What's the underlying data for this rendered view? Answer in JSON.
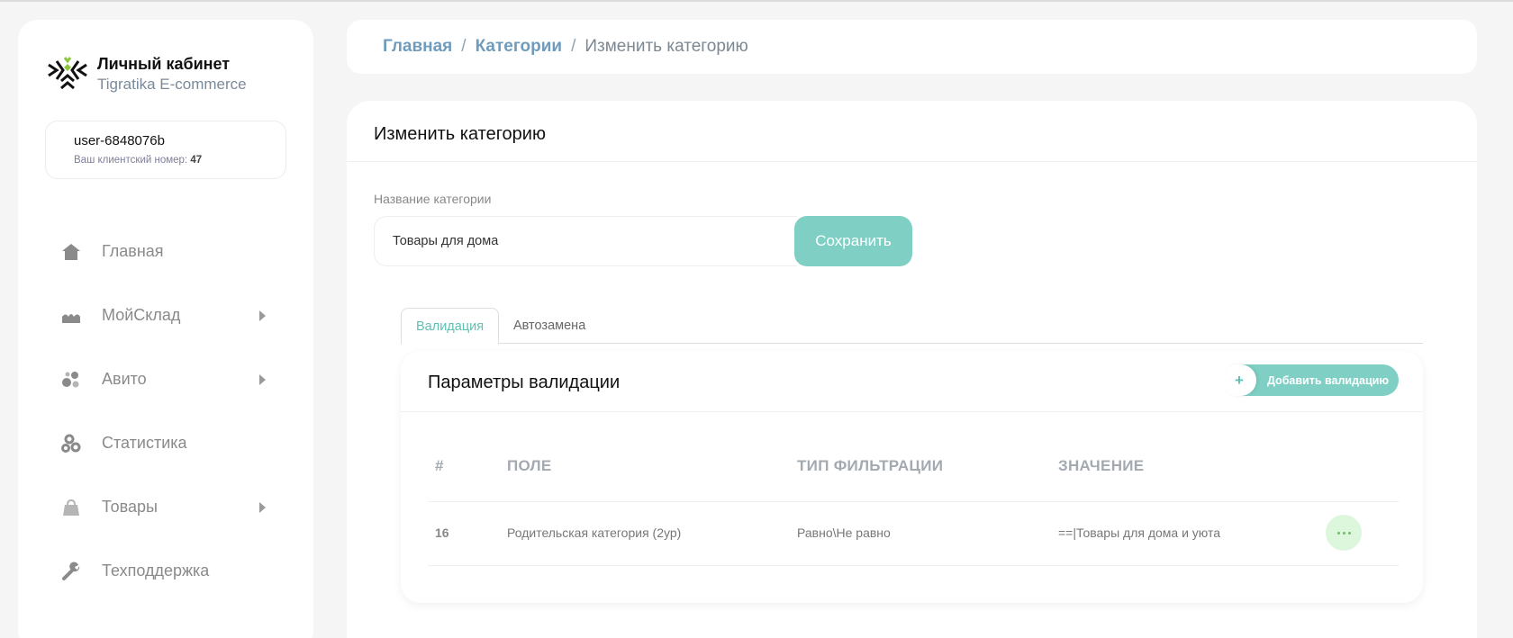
{
  "brand": {
    "title": "Личный кабинет",
    "subtitle": "Tigratika E-commerce"
  },
  "user": {
    "name": "user-6848076b",
    "client_label": "Ваш клиентский номер:",
    "client_number": "47"
  },
  "sidebar": {
    "items": [
      {
        "label": "Главная",
        "icon": "home-icon",
        "has_submenu": false
      },
      {
        "label": "МойСклад",
        "icon": "warehouse-icon",
        "has_submenu": true
      },
      {
        "label": "Авито",
        "icon": "circles-icon",
        "has_submenu": true
      },
      {
        "label": "Статистика",
        "icon": "gears-icon",
        "has_submenu": false
      },
      {
        "label": "Товары",
        "icon": "bag-icon",
        "has_submenu": true
      },
      {
        "label": "Техподдержка",
        "icon": "wrench-icon",
        "has_submenu": false
      }
    ]
  },
  "breadcrumb": {
    "home": "Главная",
    "sep1": "/",
    "categories": "Категории",
    "sep2": "/",
    "current": "Изменить категорию"
  },
  "main": {
    "title": "Изменить категорию",
    "field_label": "Название категории",
    "category_name": "Товары для дома",
    "save_label": "Сохранить"
  },
  "tabs": {
    "validation": "Валидация",
    "autoreplace": "Автозамена"
  },
  "validation": {
    "title": "Параметры валидации",
    "add_icon": "+",
    "add_label": "Добавить валидацию",
    "columns": {
      "num": "#",
      "field": "ПОЛЕ",
      "filter": "ТИП ФИЛЬТРАЦИИ",
      "value": "ЗНАЧЕНИЕ"
    },
    "rows": [
      {
        "id": "16",
        "field": "Родительская категория (2ур)",
        "filter": "Равно\\Не равно",
        "value": "==|Товары для дома и уюта"
      }
    ]
  },
  "colors": {
    "accent": "#7fcfc4",
    "link": "#6f9cbc",
    "menu_bg": "#ddf7dc"
  }
}
